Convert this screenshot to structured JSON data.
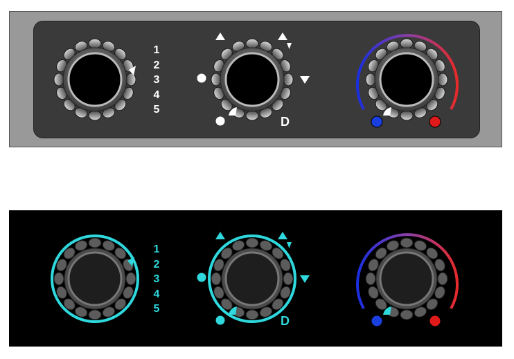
{
  "day_panel": {
    "fan": {
      "levels": [
        "1",
        "2",
        "3",
        "4",
        "5"
      ]
    },
    "mode": {
      "defrost_label": "D"
    },
    "temp": {
      "cold_color": "#1a3fe0",
      "hot_color": "#e01a1a"
    },
    "text_color": "#ffffff"
  },
  "night_panel": {
    "fan": {
      "levels": [
        "1",
        "2",
        "3",
        "4",
        "5"
      ]
    },
    "mode": {
      "defrost_label": "D"
    },
    "temp": {
      "cold_color": "#1a3fe0",
      "hot_color": "#e01a1a"
    },
    "glow_color": "#2fd8dd"
  },
  "icons": [
    "knob-fan-icon",
    "knob-mode-icon",
    "knob-temp-icon",
    "arrow-up-icon",
    "arrow-down-icon",
    "dot-icon",
    "temp-gradient-arc-icon"
  ]
}
